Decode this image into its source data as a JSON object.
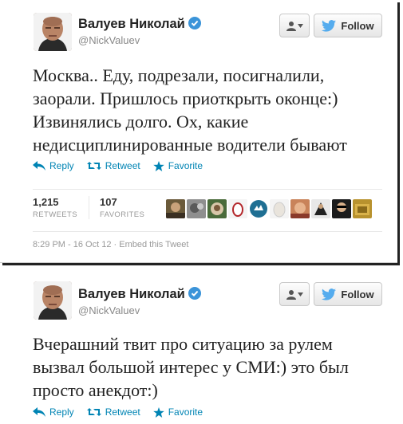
{
  "tweets": [
    {
      "author": {
        "name": "Валуев Николай",
        "handle": "@NickValuev"
      },
      "follow_label": "Follow",
      "lines": [
        "Москва.. Еду, подрезали, посигналили,",
        "заорали. Пришлось приоткрыть оконце:)",
        "Извинялись долго. Ох, какие",
        "недисциплинированные водители бывают"
      ],
      "actions": {
        "reply": "Reply",
        "retweet": "Retweet",
        "favorite": "Favorite"
      },
      "stats": {
        "retweets": {
          "count": "1,215",
          "label": "RETWEETS"
        },
        "favorites": {
          "count": "107",
          "label": "FAVORITES"
        }
      },
      "timestamp": "8:29 PM - 16 Oct 12",
      "embed_label": "Embed this Tweet"
    },
    {
      "author": {
        "name": "Валуев Николай",
        "handle": "@NickValuev"
      },
      "follow_label": "Follow",
      "lines": [
        "Вчерашний твит про ситуацию за рулем",
        "вызвал большой интерес у СМИ:) это был",
        "просто анекдот:)"
      ],
      "actions": {
        "reply": "Reply",
        "retweet": "Retweet",
        "favorite": "Favorite"
      }
    }
  ],
  "colors": {
    "link": "#0084b4",
    "verified": "#3b94d9",
    "twitter_bird": "#55acee"
  },
  "favoriters": [
    "avatar",
    "avatar",
    "avatar",
    "avatar",
    "avatar",
    "avatar",
    "avatar",
    "avatar",
    "avatar",
    "avatar"
  ]
}
